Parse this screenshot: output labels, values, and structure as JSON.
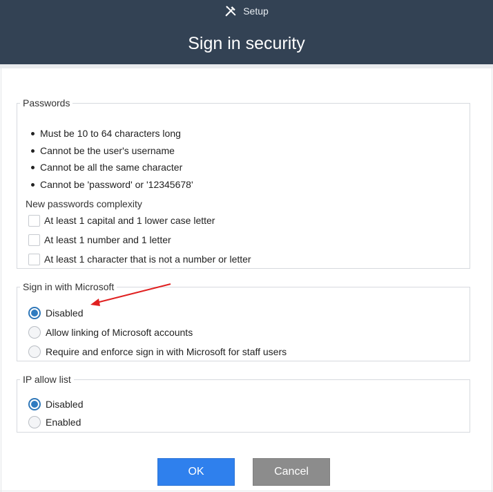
{
  "header": {
    "breadcrumb": "Setup",
    "title": "Sign in security",
    "icon": "tools-icon",
    "background": "#334254"
  },
  "passwords": {
    "legend": "Passwords",
    "rules": [
      "Must be 10 to 64 characters long",
      "Cannot be the user's username",
      "Cannot be all the same character",
      "Cannot be 'password' or '12345678'"
    ],
    "complexity_heading": "New passwords complexity",
    "complexity_options": [
      {
        "label": "At least 1 capital and 1 lower case letter",
        "checked": false
      },
      {
        "label": "At least 1 number and 1 letter",
        "checked": false
      },
      {
        "label": "At least 1 character that is not a number or letter",
        "checked": false
      }
    ]
  },
  "microsoft": {
    "legend": "Sign in with Microsoft",
    "options": [
      {
        "label": "Disabled",
        "selected": true
      },
      {
        "label": "Allow linking of Microsoft accounts",
        "selected": false
      },
      {
        "label": "Require and enforce sign in with Microsoft for staff users",
        "selected": false
      }
    ]
  },
  "ip_allow": {
    "legend": "IP allow list",
    "options": [
      {
        "label": "Disabled",
        "selected": true
      },
      {
        "label": "Enabled",
        "selected": false
      }
    ]
  },
  "buttons": {
    "ok": "OK",
    "cancel": "Cancel"
  },
  "colors": {
    "accent": "#2f80ed",
    "radio_selected": "#2f7bc0",
    "cancel": "#8c8c8c",
    "annotation_arrow": "#e02020"
  }
}
